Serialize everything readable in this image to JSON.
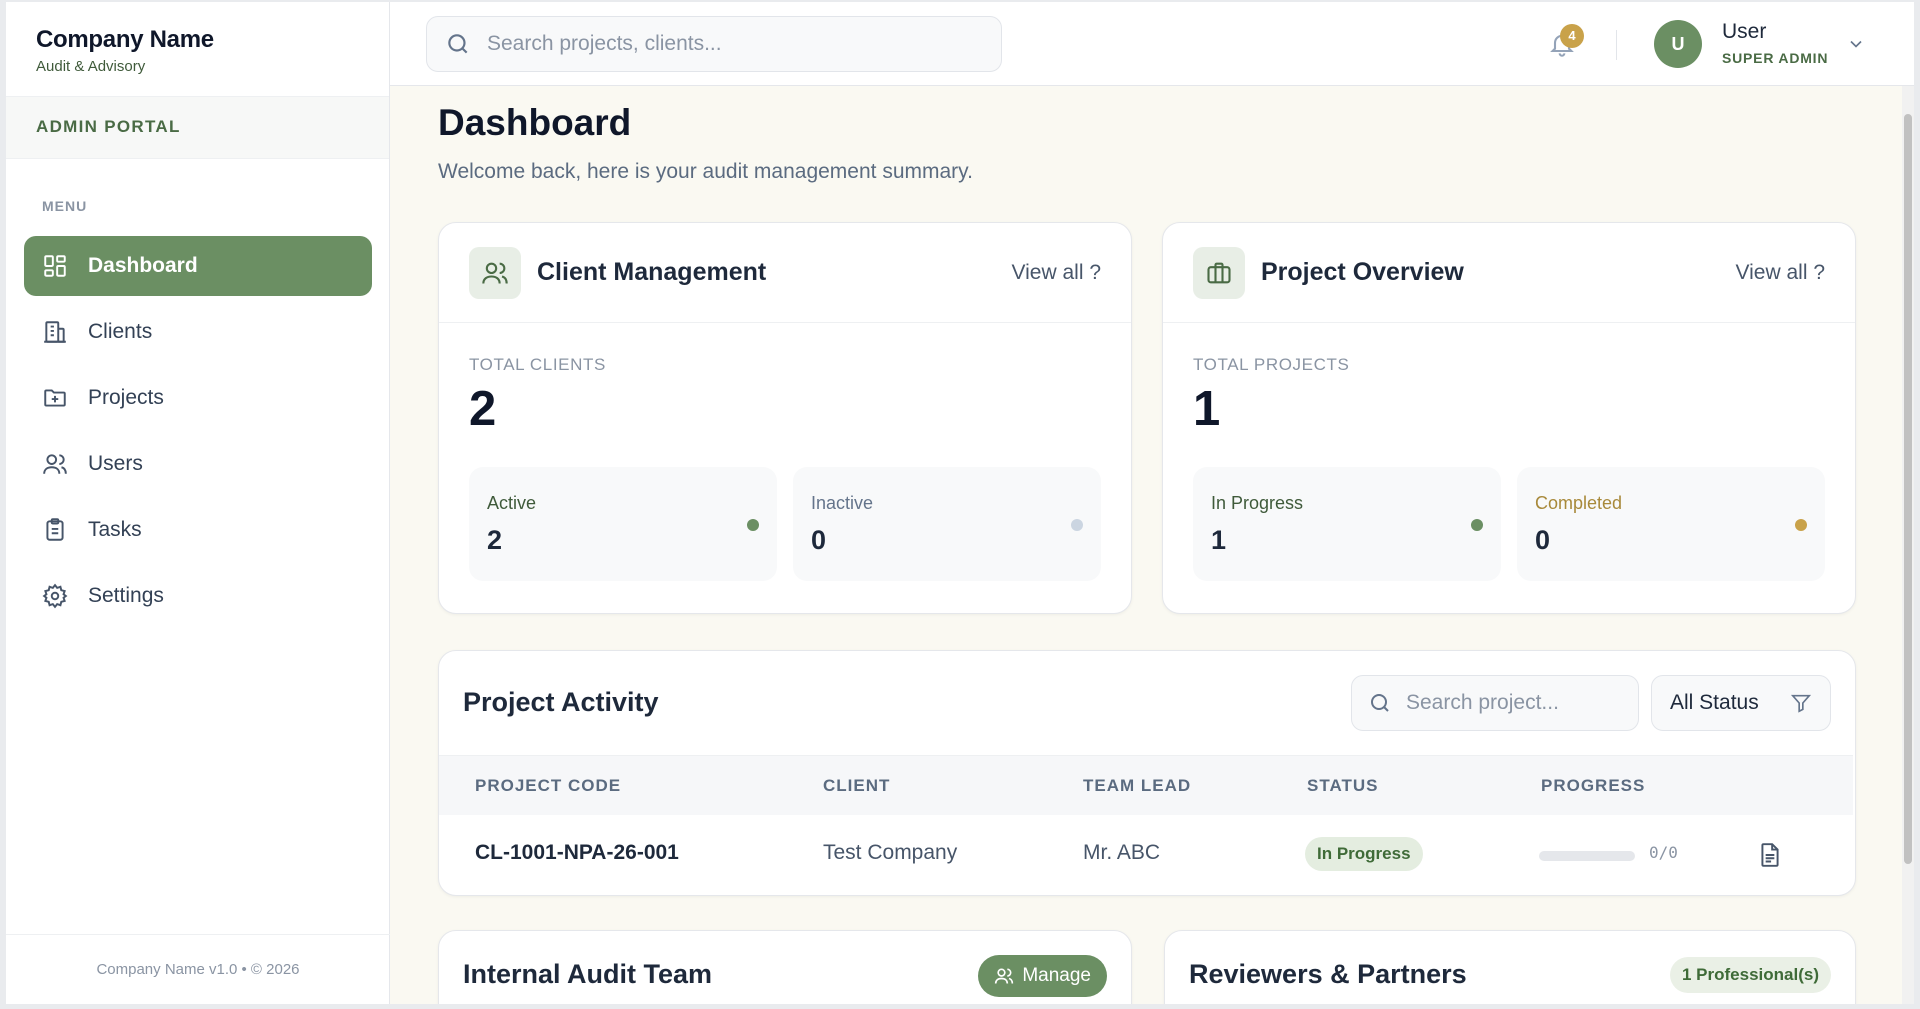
{
  "brand": {
    "name": "Company Name",
    "subtitle": "Audit & Advisory",
    "portal": "ADMIN PORTAL"
  },
  "sidebar": {
    "menu_label": "MENU",
    "items": [
      {
        "label": "Dashboard",
        "icon": "dashboard-grid-icon",
        "active": true
      },
      {
        "label": "Clients",
        "icon": "building-icon"
      },
      {
        "label": "Projects",
        "icon": "folder-plus-icon"
      },
      {
        "label": "Users",
        "icon": "users-icon"
      },
      {
        "label": "Tasks",
        "icon": "clipboard-icon"
      },
      {
        "label": "Settings",
        "icon": "gear-icon"
      }
    ],
    "footer": "Company Name v1.0 • © 2026"
  },
  "header": {
    "search_placeholder": "Search projects, clients...",
    "notifications": "4",
    "user": {
      "initial": "U",
      "name": "User",
      "role": "SUPER ADMIN"
    }
  },
  "page": {
    "title": "Dashboard",
    "subtitle": "Welcome back, here is your audit management summary."
  },
  "client_card": {
    "title": "Client Management",
    "view_all": "View all ?",
    "total_label": "TOTAL CLIENTS",
    "total": "2",
    "stats": [
      {
        "label": "Active",
        "value": "2",
        "label_color": "#3f5a3a",
        "dot_color": "#6b8f63"
      },
      {
        "label": "Inactive",
        "value": "0",
        "label_color": "#64748b",
        "dot_color": "#cbd5e1"
      }
    ]
  },
  "project_card": {
    "title": "Project Overview",
    "view_all": "View all ?",
    "total_label": "TOTAL PROJECTS",
    "total": "1",
    "stats": [
      {
        "label": "In Progress",
        "value": "1",
        "label_color": "#3f5a3a",
        "dot_color": "#6b8f63"
      },
      {
        "label": "Completed",
        "value": "0",
        "label_color": "#a8893a",
        "dot_color": "#c9a24a"
      }
    ]
  },
  "activity": {
    "title": "Project Activity",
    "search_placeholder": "Search project...",
    "filter": "All Status",
    "columns": [
      "PROJECT CODE",
      "CLIENT",
      "TEAM LEAD",
      "STATUS",
      "PROGRESS"
    ],
    "rows": [
      {
        "code": "CL-1001-NPA-26-001",
        "client": "Test Company",
        "lead": "Mr. ABC",
        "status": "In Progress",
        "progress": 0,
        "progress_text": "0/0"
      }
    ]
  },
  "audit_team": {
    "title": "Internal Audit Team",
    "button": "Manage"
  },
  "reviewers": {
    "title": "Reviewers & Partners",
    "badge": "1 Professional(s)"
  },
  "colors": {
    "accent": "#6b8f63",
    "gold": "#c9a24a",
    "background": "#faf9f2"
  }
}
